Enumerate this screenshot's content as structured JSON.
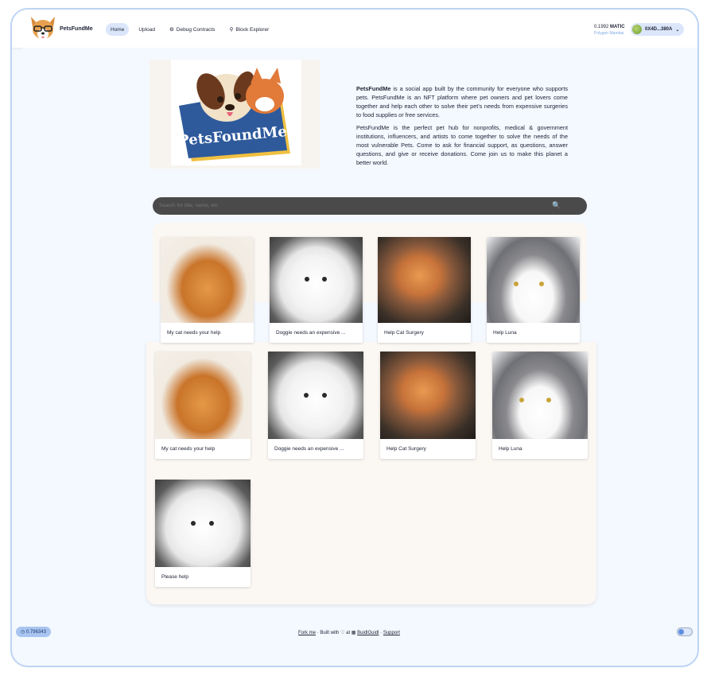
{
  "header": {
    "brand": "PetsFundMe",
    "nav": [
      {
        "label": "Home",
        "icon": ""
      },
      {
        "label": "Upload",
        "icon": ""
      },
      {
        "label": "Debug Contracts",
        "icon": "bug-icon"
      },
      {
        "label": "Block Explorer",
        "icon": "magnifier-icon"
      }
    ],
    "balance_value": "0.1992",
    "balance_unit": "MATIC",
    "network": "Polygon Mumbai",
    "wallet_address": "0X4D...380A"
  },
  "hero": {
    "logo_text": "PetsFoundMe",
    "p1_brand": "PetsFundMe",
    "p1_rest": " is a social app built by the community for everyone who supports pets. PetsFundMe is an NFT platform where pet owners and pet lovers come together and help each other to solve their pet's needs from expensive surgeries to food supplies or free services.",
    "p2": "PetsFundMe is the perfect pet hub for nonprofits, medical & government institutions, influencers, and artists to come together to solve the needs of the most vulnerable Pets. Come to ask for financial support, as questions, answer questions, and give or receive donations. Come join us to make this planet a better world."
  },
  "search": {
    "placeholder": "Search for title, name, etc"
  },
  "cards": [
    {
      "caption": "My cat needs your help",
      "image": "orange-cat"
    },
    {
      "caption": "Doggie needs an expensive ...",
      "image": "white-dog"
    },
    {
      "caption": "Help Cat Surgery",
      "image": "orange-kitten"
    },
    {
      "caption": "Help Luna",
      "image": "grey-white-cat"
    },
    {
      "caption": "My cat needs your help",
      "image": "orange-cat"
    },
    {
      "caption": "Doggie needs an expensive ...",
      "image": "white-dog"
    },
    {
      "caption": "Help Cat Surgery",
      "image": "orange-kitten"
    },
    {
      "caption": "Help Luna",
      "image": "grey-white-cat"
    },
    {
      "caption": "Please help",
      "image": "white-dog"
    }
  ],
  "footer": {
    "version": "0.796343",
    "fork": "Fork me",
    "built_with": "Built with",
    "at": "at",
    "buidlguidl": "BuidlGuidl",
    "support": "Support"
  }
}
